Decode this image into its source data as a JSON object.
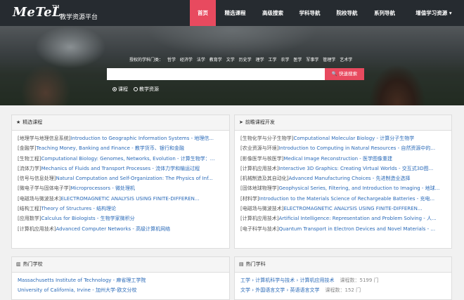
{
  "brand": {
    "name": "MeTeL",
    "tm": "TM",
    "subtitle": "教学资源平台"
  },
  "nav": [
    {
      "label": "首页",
      "active": true
    },
    {
      "label": "精选课程"
    },
    {
      "label": "高级搜索"
    },
    {
      "label": "学科导航"
    },
    {
      "label": "院校导航"
    },
    {
      "label": "系列导航"
    },
    {
      "label": "增值学习资源 ▾"
    }
  ],
  "hero": {
    "subjects_prefix": "授权的学科门类：",
    "subjects": [
      "哲学",
      "经济学",
      "法学",
      "教育学",
      "文学",
      "历史学",
      "理学",
      "工学",
      "农学",
      "医学",
      "军事学",
      "管理学",
      "艺术学"
    ],
    "search_placeholder": "",
    "search_button": "🔍 快速搜索",
    "radio_course": "课程",
    "radio_resource": "教学资源"
  },
  "featured": {
    "title": "精选课程",
    "items": [
      {
        "cat": "[地理学与地理信息系统]",
        "title": "Introduction to Geographic Information Systems - 地理信..."
      },
      {
        "cat": "[金融学]",
        "title": "Teaching Money, Banking and Finance - 教学货币、银行和金融"
      },
      {
        "cat": "[生物工程]",
        "title": "Computational Biology: Genomes, Networks, Evolution - 计算生物学：..."
      },
      {
        "cat": "[流体力学]",
        "title": "Mechanics of Fluids and Transport Processes - 流体力学和输运过程"
      },
      {
        "cat": "[信号与信息处理]",
        "title": "Natural Computation and Self-Organization: The Physics of Inf..."
      },
      {
        "cat": "[微电子学与固体电子学]",
        "title": "Microprocessors - 微处理机"
      },
      {
        "cat": "[电磁场与微波技术]",
        "title": "ELECTROMAGNETIC ANALYSIS USING FINITE-DIFFEREN..."
      },
      {
        "cat": "[结构工程]",
        "title": "Theory of Structures - 结构理论"
      },
      {
        "cat": "[应用数学]",
        "title": "Calculus for Biologists - 生物学家微积分"
      },
      {
        "cat": "[计算机应用技术]",
        "title": "Advanced Computer Networks - 高级计算机网络"
      }
    ]
  },
  "frontier": {
    "title": "前瞻课程开发",
    "items": [
      {
        "cat": "[生物化学与分子生物学]",
        "title": "Computational Molecular Biology - 计算分子生物学"
      },
      {
        "cat": "[农业资源与环境]",
        "title": "Introduction to Computing in Natural Resources - 自然资源中的..."
      },
      {
        "cat": "[影像医学与核医学]",
        "title": "Medical Image Reconstruction - 医学图像重建"
      },
      {
        "cat": "[计算机应用技术]",
        "title": "Interactive 3D Graphics: Creating Virtual Worlds - 交互式3D图..."
      },
      {
        "cat": "[机械制造及其自动化]",
        "title": "Advanced Manufacturing Choices - 先进制造业选择"
      },
      {
        "cat": "[固体地球物理学]",
        "title": "Geophysical Series, Filtering, and Introduction to Imaging - 地球..."
      },
      {
        "cat": "[材料学]",
        "title": "Introduction to the Materials Science of Rechargeable Batteries - 充电..."
      },
      {
        "cat": "[电磁场与微波技术]",
        "title": "ELECTROMAGNETIC ANALYSIS USING FINITE-DIFFEREN..."
      },
      {
        "cat": "[计算机应用技术]",
        "title": "Artificial Intelligence: Representation and Problem Solving - 人..."
      },
      {
        "cat": "[电子科学与技术]",
        "title": "Quantum Transport in Electron Devices and Novel Materials - ..."
      }
    ]
  },
  "schools": {
    "title": "热门学校",
    "items": [
      "Massachusetts Institute of Technology - 麻省理工学院",
      "University of California, Irvine - 加州大学-欧文分校"
    ]
  },
  "disciplines": {
    "title": "热门学科",
    "items": [
      {
        "path": "工学 › 计算机科学与技术 › 计算机应用技术",
        "count": "课程数：5199 门"
      },
      {
        "path": "文学 › 外国语言文学 › 英语语言文学",
        "count": "课程数：152 门"
      }
    ]
  }
}
